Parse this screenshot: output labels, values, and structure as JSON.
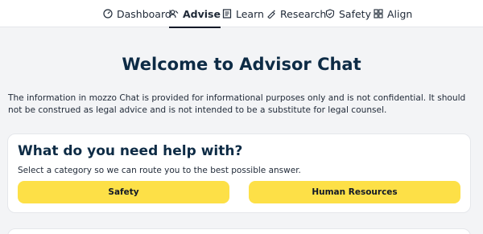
{
  "nav": {
    "items": [
      {
        "label": "Dashboard",
        "icon": "dashboard-icon"
      },
      {
        "label": "Advise",
        "icon": "advise-icon",
        "active": true
      },
      {
        "label": "Learn",
        "icon": "learn-icon"
      },
      {
        "label": "Research",
        "icon": "research-icon"
      },
      {
        "label": "Safety",
        "icon": "shield-icon"
      },
      {
        "label": "Align",
        "icon": "align-icon"
      }
    ]
  },
  "main": {
    "title": "Welcome to Advisor Chat",
    "disclaimer": "The information in mozzo Chat is provided for informational purposes only and is not confidential. It should not be construed as legal advice and is not intended to be a substitute for legal counsel."
  },
  "help_card": {
    "title": "What do you need help with?",
    "subtitle": "Select a category so we can route you to the best possible answer.",
    "categories": [
      "Safety",
      "Human Resources"
    ]
  },
  "colors": {
    "accent": "#fde047",
    "heading": "#0d2b45",
    "background": "#f3f4f6"
  }
}
